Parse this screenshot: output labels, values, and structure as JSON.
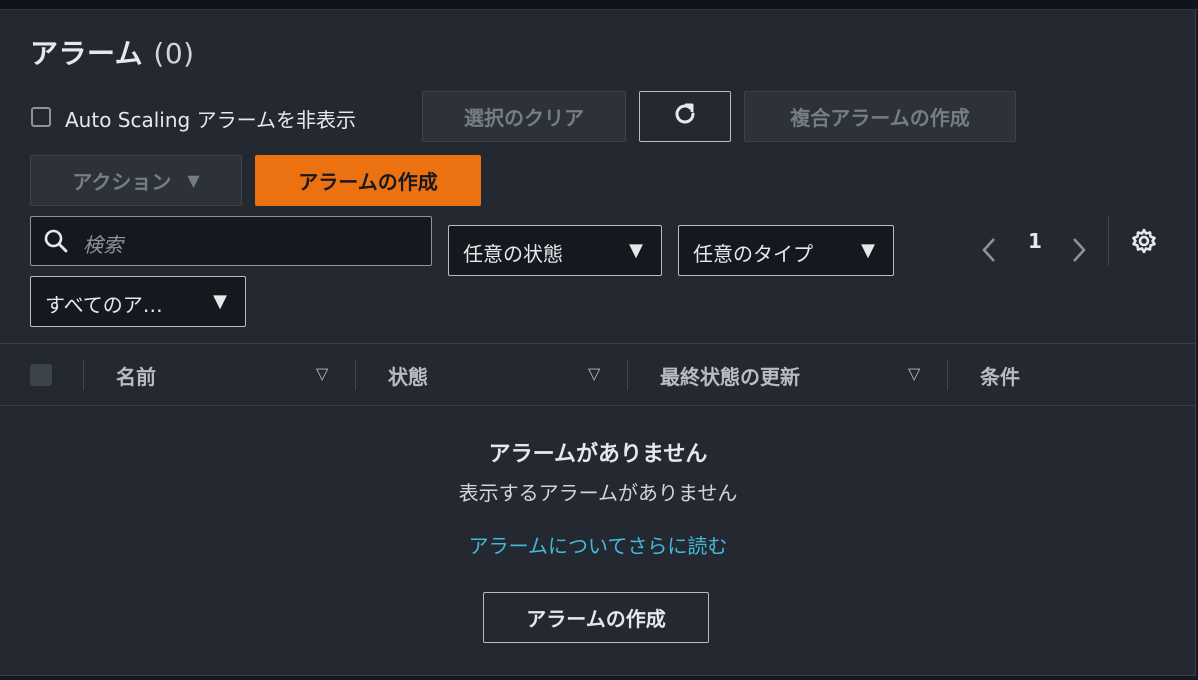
{
  "header": {
    "title": "アラーム",
    "count": "(0)"
  },
  "toolbar": {
    "hide_autoscaling_label": "Auto Scaling アラームを非表示",
    "clear_selection_label": "選択のクリア",
    "refresh_icon": "refresh-icon",
    "create_composite_label": "複合アラームの作成",
    "actions_label": "アクション",
    "create_alarm_label": "アラームの作成"
  },
  "filters": {
    "search_placeholder": "検索",
    "state_select": "任意の状態",
    "type_select": "任意のタイプ",
    "actions_select": "すべてのア…"
  },
  "pagination": {
    "current_page": "1",
    "prev_icon": "chevron-left-icon",
    "next_icon": "chevron-right-icon",
    "settings_icon": "gear-icon"
  },
  "table": {
    "columns": [
      "名前",
      "状態",
      "最終状態の更新",
      "条件"
    ]
  },
  "empty_state": {
    "title": "アラームがありません",
    "subtitle": "表示するアラームがありません",
    "link": "アラームについてさらに読む",
    "create_button": "アラームの作成"
  },
  "colors": {
    "primary": "#ec7211",
    "link": "#44b9d6",
    "background": "#232831"
  }
}
